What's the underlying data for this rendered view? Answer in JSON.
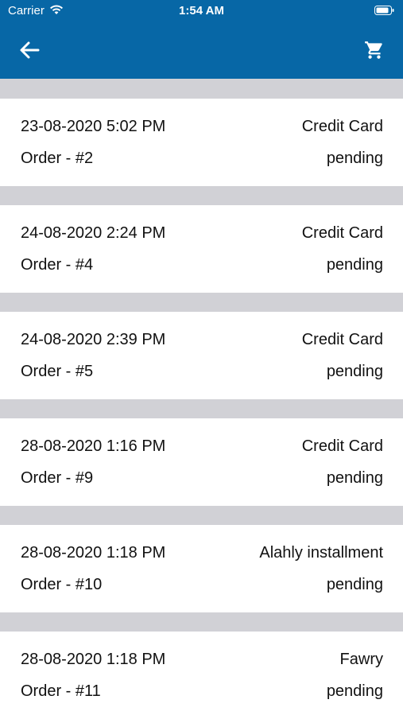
{
  "status_bar": {
    "carrier": "Carrier",
    "time": "1:54 AM"
  },
  "app_bar": {
    "back_icon": "arrow-left-icon",
    "cart_icon": "shopping-cart-icon",
    "background": "#0767a6"
  },
  "orders": [
    {
      "date": "23-08-2020 5:02 PM",
      "payment_method": "Credit Card",
      "order": "Order - #2",
      "status": "pending"
    },
    {
      "date": "24-08-2020 2:24 PM",
      "payment_method": "Credit Card",
      "order": "Order - #4",
      "status": "pending"
    },
    {
      "date": "24-08-2020 2:39 PM",
      "payment_method": "Credit Card",
      "order": "Order - #5",
      "status": "pending"
    },
    {
      "date": "28-08-2020 1:16 PM",
      "payment_method": "Credit Card",
      "order": "Order - #9",
      "status": "pending"
    },
    {
      "date": "28-08-2020 1:18 PM",
      "payment_method": "Alahly installment",
      "order": "Order - #10",
      "status": "pending"
    },
    {
      "date": "28-08-2020 1:18 PM",
      "payment_method": "Fawry",
      "order": "Order - #11",
      "status": "pending"
    }
  ]
}
